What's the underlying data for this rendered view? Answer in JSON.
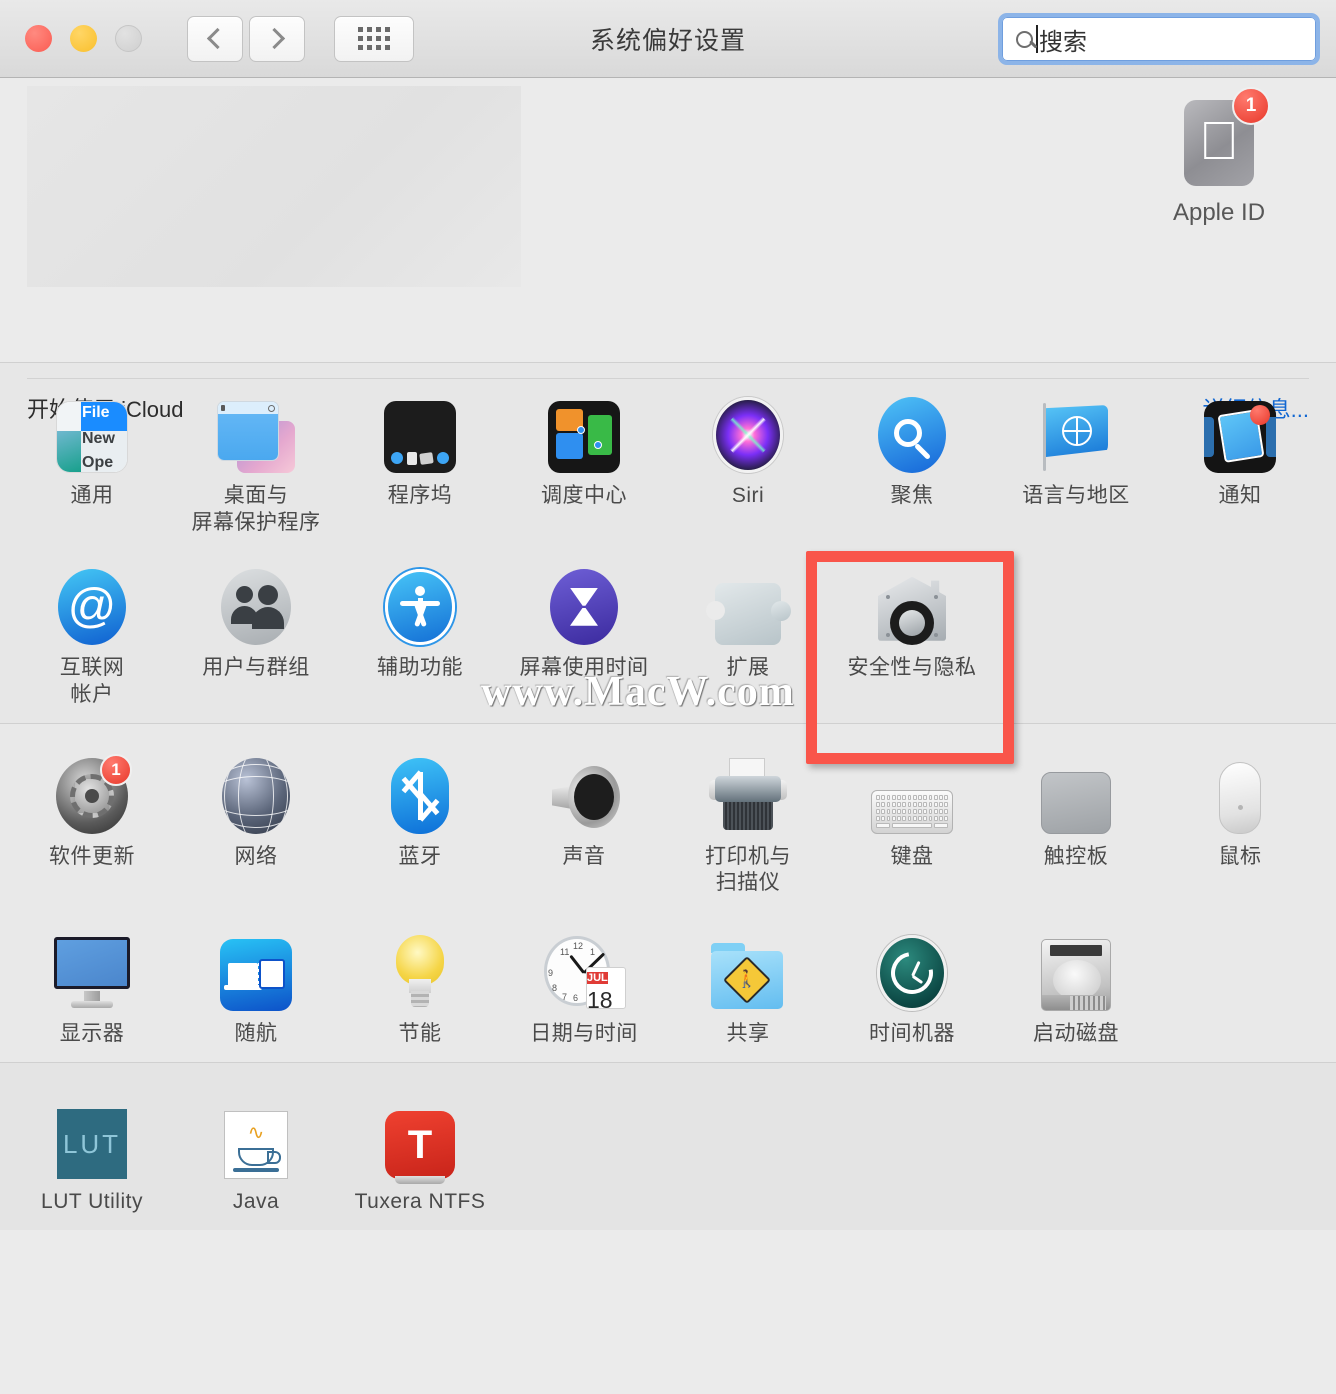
{
  "window": {
    "title": "系统偏好设置",
    "traffic_lights": [
      "close",
      "minimize",
      "zoom"
    ],
    "back_label": "后退",
    "forward_label": "前进",
    "grid_label": "显示全部"
  },
  "search": {
    "placeholder": "搜索",
    "value": "",
    "focused": true,
    "focus_ring_color": "#8cb4e8"
  },
  "banner": {
    "apple_id_label": "Apple ID",
    "apple_id_badge": "1",
    "icloud_text": "开始使用 iCloud",
    "icloud_more": "详细信息...",
    "link_color": "#1167d2"
  },
  "sections": [
    {
      "id": "section-personal",
      "rows": [
        [
          {
            "label": "通用",
            "icon": "general-icon",
            "art": {
              "t1": "File",
              "t2": "New",
              "t3": "Ope"
            }
          },
          {
            "label": "桌面与\n屏幕保护程序",
            "icon": "desktop-screensaver-icon"
          },
          {
            "label": "程序坞",
            "icon": "dock-icon"
          },
          {
            "label": "调度中心",
            "icon": "mission-control-icon"
          },
          {
            "label": "Siri",
            "icon": "siri-icon"
          },
          {
            "label": "聚焦",
            "icon": "spotlight-icon"
          },
          {
            "label": "语言与地区",
            "icon": "language-region-icon"
          },
          {
            "label": "通知",
            "icon": "notifications-icon"
          }
        ],
        [
          {
            "label": "互联网\n帐户",
            "icon": "internet-accounts-icon"
          },
          {
            "label": "用户与群组",
            "icon": "users-groups-icon"
          },
          {
            "label": "辅助功能",
            "icon": "accessibility-icon"
          },
          {
            "label": "屏幕使用时间",
            "icon": "screen-time-icon"
          },
          {
            "label": "扩展",
            "icon": "extensions-icon"
          },
          {
            "label": "安全性与隐私",
            "icon": "security-privacy-icon",
            "highlighted": true
          }
        ]
      ]
    },
    {
      "id": "section-hardware",
      "rows": [
        [
          {
            "label": "软件更新",
            "icon": "software-update-icon",
            "badge": "1"
          },
          {
            "label": "网络",
            "icon": "network-icon"
          },
          {
            "label": "蓝牙",
            "icon": "bluetooth-icon"
          },
          {
            "label": "声音",
            "icon": "sound-icon"
          },
          {
            "label": "打印机与\n扫描仪",
            "icon": "printers-scanners-icon"
          },
          {
            "label": "键盘",
            "icon": "keyboard-icon"
          },
          {
            "label": "触控板",
            "icon": "trackpad-icon"
          },
          {
            "label": "鼠标",
            "icon": "mouse-icon"
          }
        ],
        [
          {
            "label": "显示器",
            "icon": "displays-icon"
          },
          {
            "label": "随航",
            "icon": "sidecar-icon"
          },
          {
            "label": "节能",
            "icon": "energy-saver-icon"
          },
          {
            "label": "日期与时间",
            "icon": "date-time-icon",
            "art": {
              "month": "JUL",
              "day": "18"
            }
          },
          {
            "label": "共享",
            "icon": "sharing-icon"
          },
          {
            "label": "时间机器",
            "icon": "time-machine-icon"
          },
          {
            "label": "启动磁盘",
            "icon": "startup-disk-icon"
          }
        ]
      ]
    },
    {
      "id": "section-third-party",
      "rows": [
        [
          {
            "label": "LUT Utility",
            "icon": "lut-utility-icon",
            "art": {
              "text": "LUT"
            }
          },
          {
            "label": "Java",
            "icon": "java-icon"
          },
          {
            "label": "Tuxera NTFS",
            "icon": "tuxera-ntfs-icon",
            "art": {
              "text": "T"
            }
          }
        ]
      ]
    }
  ],
  "highlight": {
    "color": "#f9554a",
    "target": "安全性与隐私"
  },
  "watermark": {
    "text": "www.MacW.com"
  }
}
